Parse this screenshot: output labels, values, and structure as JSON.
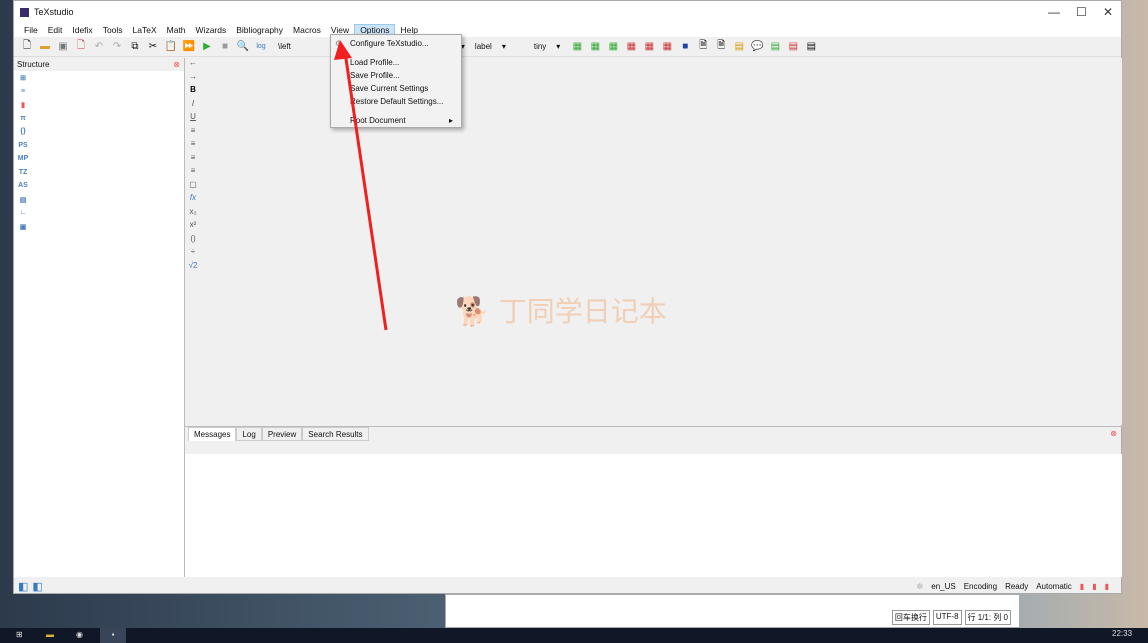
{
  "window": {
    "title": "TeXstudio"
  },
  "menu": [
    "File",
    "Edit",
    "Idefix",
    "Tools",
    "LaTeX",
    "Math",
    "Wizards",
    "Bibliography",
    "Macros",
    "View",
    "Options",
    "Help"
  ],
  "toolbar": {
    "left_combo": "\\left",
    "label_combo": "label",
    "size_combo": "tiny"
  },
  "options_menu": {
    "configure": "Configure TeXstudio...",
    "load_profile": "Load Profile...",
    "save_profile": "Save Profile...",
    "save_current": "Save Current Settings",
    "restore": "Restore Default Settings...",
    "root_document": "Root Document"
  },
  "structure": {
    "title": "Structure",
    "icons": [
      "PS",
      "MP",
      "TZ",
      "AS"
    ]
  },
  "math_col": [
    "B",
    "I",
    "U",
    "fx",
    "x₂",
    "x²",
    "√2"
  ],
  "tabs": [
    "Messages",
    "Log",
    "Preview",
    "Search Results"
  ],
  "status": {
    "language": "en_US",
    "encoding": "Encoding",
    "state": "Ready",
    "mode": "Automatic"
  },
  "behind": {
    "eol": "回车换行",
    "enc": "UTF-8",
    "pos": "行 1/1: 列 0"
  },
  "watermark": "丁同学日记本",
  "taskbar": {
    "time": "22:33"
  }
}
